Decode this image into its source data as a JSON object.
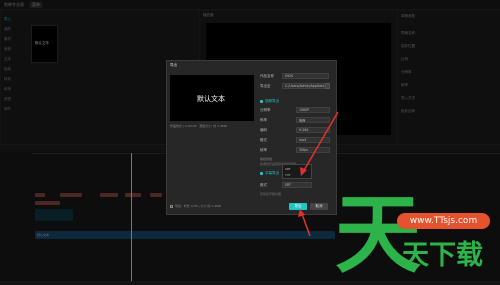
{
  "app": {
    "title": "剪映专业版",
    "menu_label": "菜单"
  },
  "left_panel": {
    "tabs": [
      "导入",
      "我的",
      "素材",
      "音频",
      "文本",
      "贴纸",
      "特效",
      "转场",
      "滤镜",
      "调节"
    ],
    "thumb_text": "默认文本"
  },
  "player": {
    "title": "播放器"
  },
  "right_panel": {
    "title": "草稿参数",
    "rows": [
      "草稿名称",
      "保存位置",
      "比例",
      "分辨率",
      "帧率",
      "导入方式",
      "色彩空间"
    ]
  },
  "dialog": {
    "title": "导出",
    "preview_text": "默认文本",
    "preview_caption": "作品时长 | 0:00:05 · 预估大小: 约 1.4MB",
    "name_label": "作品名称",
    "name_value": "0920",
    "path_label": "导出至",
    "path_value": "C:/Users/Admin/AppData/Local/JianyingPro",
    "video_section": "视频导出",
    "rows": [
      {
        "label": "分辨率",
        "value": "1080P"
      },
      {
        "label": "码率",
        "value": "推荐"
      },
      {
        "label": "编码",
        "value": "H.264"
      },
      {
        "label": "格式",
        "value": "mp4"
      },
      {
        "label": "帧率",
        "value": "30fps"
      }
    ],
    "copyright_label": "版权校验",
    "copyright_note": "检测音乐是否存在版权风险",
    "subtitle_section": "字幕导出",
    "subtitle_options": [
      "SRT",
      "TXT"
    ],
    "subtitle_format_label": "格式",
    "subtitle_format_value": "SRT",
    "subtitle_note": "仅导出字幕内容",
    "footer_text": "导出 · 时长 0:05 | 大小 约 1.4MB",
    "export_button": "导出",
    "cancel_button": "取消"
  },
  "timeline": {
    "clip_label": "默认文本"
  },
  "watermark": {
    "big_char": "天",
    "url": "www.TTsjs.com",
    "brand": "天下载"
  }
}
